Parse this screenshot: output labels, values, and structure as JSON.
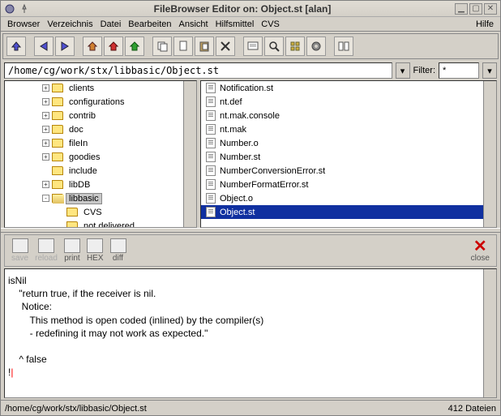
{
  "window": {
    "title": "FileBrowser Editor on: Object.st  [alan]"
  },
  "menubar": {
    "items": [
      "Browser",
      "Verzeichnis",
      "Datei",
      "Bearbeiten",
      "Ansicht",
      "Hilfsmittel",
      "CVS"
    ],
    "help": "Hilfe"
  },
  "pathbar": {
    "path": "/home/cg/work/stx/libbasic/Object.st",
    "filter_label": "Filter:",
    "filter_value": "*"
  },
  "tree": {
    "items": [
      {
        "indent": 40,
        "expand": "+",
        "name": "clients",
        "selected": false,
        "open": false
      },
      {
        "indent": 40,
        "expand": "+",
        "name": "configurations",
        "selected": false,
        "open": false
      },
      {
        "indent": 40,
        "expand": "+",
        "name": "contrib",
        "selected": false,
        "open": false
      },
      {
        "indent": 40,
        "expand": "+",
        "name": "doc",
        "selected": false,
        "open": false
      },
      {
        "indent": 40,
        "expand": "+",
        "name": "fileIn",
        "selected": false,
        "open": false
      },
      {
        "indent": 40,
        "expand": "+",
        "name": "goodies",
        "selected": false,
        "open": false
      },
      {
        "indent": 40,
        "expand": "",
        "name": "include",
        "selected": false,
        "open": false
      },
      {
        "indent": 40,
        "expand": "+",
        "name": "libDB",
        "selected": false,
        "open": false
      },
      {
        "indent": 40,
        "expand": "-",
        "name": "libbasic",
        "selected": true,
        "open": true
      },
      {
        "indent": 58,
        "expand": "",
        "name": "CVS",
        "selected": false,
        "open": false
      },
      {
        "indent": 58,
        "expand": "",
        "name": "not delivered",
        "selected": false,
        "open": false
      }
    ]
  },
  "files": {
    "items": [
      {
        "name": "Notification.st",
        "selected": false
      },
      {
        "name": "nt.def",
        "selected": false
      },
      {
        "name": "nt.mak.console",
        "selected": false
      },
      {
        "name": "nt.mak",
        "selected": false
      },
      {
        "name": "Number.o",
        "selected": false
      },
      {
        "name": "Number.st",
        "selected": false
      },
      {
        "name": "NumberConversionError.st",
        "selected": false
      },
      {
        "name": "NumberFormatError.st",
        "selected": false
      },
      {
        "name": "Object.o",
        "selected": false
      },
      {
        "name": "Object.st",
        "selected": true
      }
    ]
  },
  "edit_toolbar": {
    "save": "save",
    "reload": "reload",
    "print": "print",
    "hex": "HEX",
    "diff": "diff",
    "close": "close"
  },
  "editor": {
    "content": "isNil\n    \"return true, if the receiver is nil.\n     Notice:\n        This method is open coded (inlined) by the compiler(s)\n        - redefining it may not work as expected.\"\n\n    ^ false\n!"
  },
  "statusbar": {
    "path": "/home/cg/work/stx/libbasic/Object.st",
    "count": "412 Dateien"
  },
  "icons": {
    "up1": "up",
    "back": "back",
    "fwd": "forward",
    "home1": "home1",
    "home2": "home2",
    "home3": "home3",
    "copy": "copy",
    "cut": "cut",
    "paste": "paste",
    "del": "delete",
    "clip": "clipboard",
    "find": "find",
    "pkg": "package",
    "gear": "gear",
    "diff2": "diff"
  }
}
